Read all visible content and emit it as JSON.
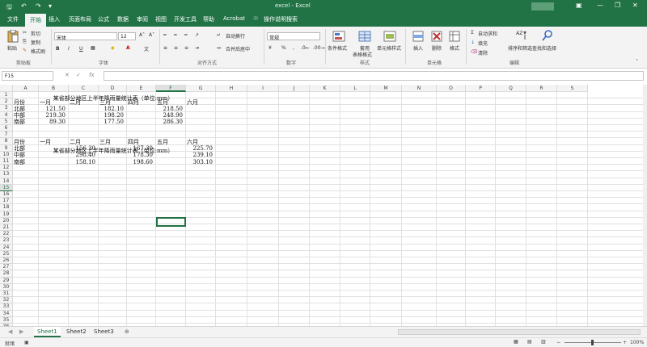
{
  "window": {
    "title": "excel - Excel",
    "accent": "#217346"
  },
  "tabs": [
    "文件",
    "开始",
    "插入",
    "页面布局",
    "公式",
    "数据",
    "审阅",
    "视图",
    "开发工具",
    "帮助",
    "Acrobat",
    "操作说明搜索"
  ],
  "active_tab": "开始",
  "ribbon": {
    "paste": "粘贴",
    "cut": "剪切",
    "copy": "复制",
    "format_painter": "格式刷",
    "clipboard_group": "剪贴板",
    "font_name": "宋体",
    "font_size": "12",
    "font_group": "字体",
    "wrap_text": "自动换行",
    "merge_center": "合并后居中",
    "alignment_group": "对齐方式",
    "number_format": "常规",
    "number_group": "数字",
    "cond_format": "条件格式",
    "table_format_1": "套用",
    "table_format_2": "表格格式",
    "cell_style": "单元格样式",
    "styles_group": "样式",
    "insert": "插入",
    "delete": "删除",
    "format": "格式",
    "cells_group": "单元格",
    "autosum": "自动求和",
    "fill": "填充",
    "clear": "清除",
    "sort_filter": "排序和筛选",
    "find_select": "查找和选择",
    "editing_group": "编辑"
  },
  "formula_bar": {
    "name_box": "F15",
    "fx": "fx",
    "value": ""
  },
  "columns": [
    "A",
    "B",
    "C",
    "D",
    "E",
    "F",
    "G",
    "H",
    "I",
    "J",
    "K",
    "L",
    "M",
    "N",
    "O",
    "P",
    "Q",
    "R",
    "S"
  ],
  "selected_column": "F",
  "selected_row": "15",
  "rows": [
    "1",
    "2",
    "3",
    "4",
    "5",
    "6",
    "7",
    "8",
    "9",
    "10",
    "11",
    "12",
    "13",
    "14",
    "15",
    "16",
    "17",
    "18",
    "19",
    "20",
    "21",
    "22",
    "23",
    "24",
    "25",
    "26",
    "27",
    "28",
    "29",
    "30",
    "31",
    "32",
    "33",
    "34",
    "35",
    "36",
    "37",
    "38"
  ],
  "sheet": {
    "table1": {
      "title": "某省部分地区上半年降雨量统计表（单位:mm）",
      "header": [
        "月份",
        "一月",
        "二月",
        "三月",
        "四月",
        "五月",
        "六月"
      ],
      "rows": [
        [
          "北部",
          "121.50",
          "",
          "182.10",
          "",
          "218.50",
          ""
        ],
        [
          "中部",
          "219.30",
          "",
          "198.20",
          "",
          "248.90",
          ""
        ],
        [
          "南部",
          "89.30",
          "",
          "177.50",
          "",
          "286.30",
          ""
        ]
      ]
    },
    "table2": {
      "title": "某省部分地区上半年降雨量统计表（单位:mm）",
      "header": [
        "月份",
        "一月",
        "二月",
        "三月",
        "四月",
        "五月",
        "六月"
      ],
      "rows": [
        [
          "北部",
          "",
          "156.30",
          "",
          "167.30",
          "",
          "225.70"
        ],
        [
          "中部",
          "",
          "298.40",
          "",
          "178.30",
          "",
          "239.10"
        ],
        [
          "南部",
          "",
          "158.10",
          "",
          "198.60",
          "",
          "303.10"
        ]
      ]
    }
  },
  "sheets": [
    "Sheet1",
    "Sheet2",
    "Sheet3"
  ],
  "active_sheet": "Sheet1",
  "status": {
    "ready": "就绪",
    "zoom": "100%"
  }
}
